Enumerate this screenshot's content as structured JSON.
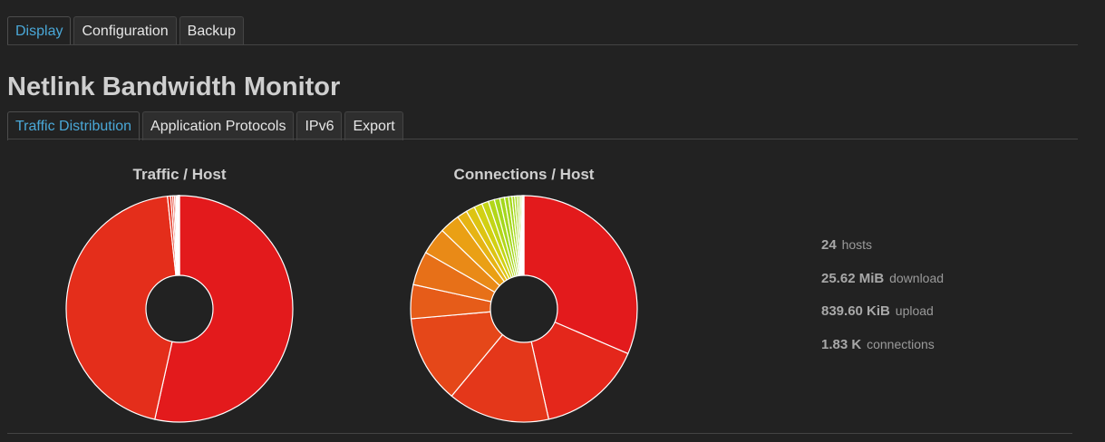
{
  "top_tabs": [
    {
      "label": "Display",
      "active": true
    },
    {
      "label": "Configuration",
      "active": false
    },
    {
      "label": "Backup",
      "active": false
    }
  ],
  "page_title": "Netlink Bandwidth Monitor",
  "sub_tabs": [
    {
      "label": "Traffic Distribution",
      "active": true
    },
    {
      "label": "Application Protocols",
      "active": false
    },
    {
      "label": "IPv6",
      "active": false
    },
    {
      "label": "Export",
      "active": false
    }
  ],
  "stats": {
    "hosts": {
      "value": "24",
      "unit": "hosts"
    },
    "download": {
      "value": "25.62 MiB",
      "unit": "download"
    },
    "upload": {
      "value": "839.60 KiB",
      "unit": "upload"
    },
    "connections": {
      "value": "1.83 K",
      "unit": "connections"
    }
  },
  "chart_data": [
    {
      "type": "pie",
      "title": "Traffic / Host",
      "values": [
        53.5,
        44.8,
        0.45,
        0.3,
        0.25,
        0.2,
        0.15,
        0.1,
        0.08,
        0.05,
        0.04,
        0.03,
        0.02,
        0.01,
        0.01,
        0.01
      ],
      "colors": [
        "#e31a1c",
        "#e42e1b"
      ],
      "donut": true
    },
    {
      "type": "pie",
      "title": "Connections / Host",
      "values": [
        32.5,
        15.5,
        15,
        13,
        5,
        5,
        4,
        3,
        1.5,
        1.3,
        1.2,
        1,
        0.9,
        0.8,
        0.7,
        0.6,
        0.5,
        0.4,
        0.35,
        0.3,
        0.25,
        0.2,
        0.15,
        0.1
      ],
      "colors": [
        "#e31a1c",
        "#e4271b",
        "#e4371a",
        "#e54719",
        "#e65c19",
        "#e77018",
        "#e98a17",
        "#eaa014",
        "#e6b414",
        "#ddc412",
        "#d2d013",
        "#c3d516",
        "#b2d619",
        "#a5d71c"
      ],
      "donut": true
    }
  ]
}
